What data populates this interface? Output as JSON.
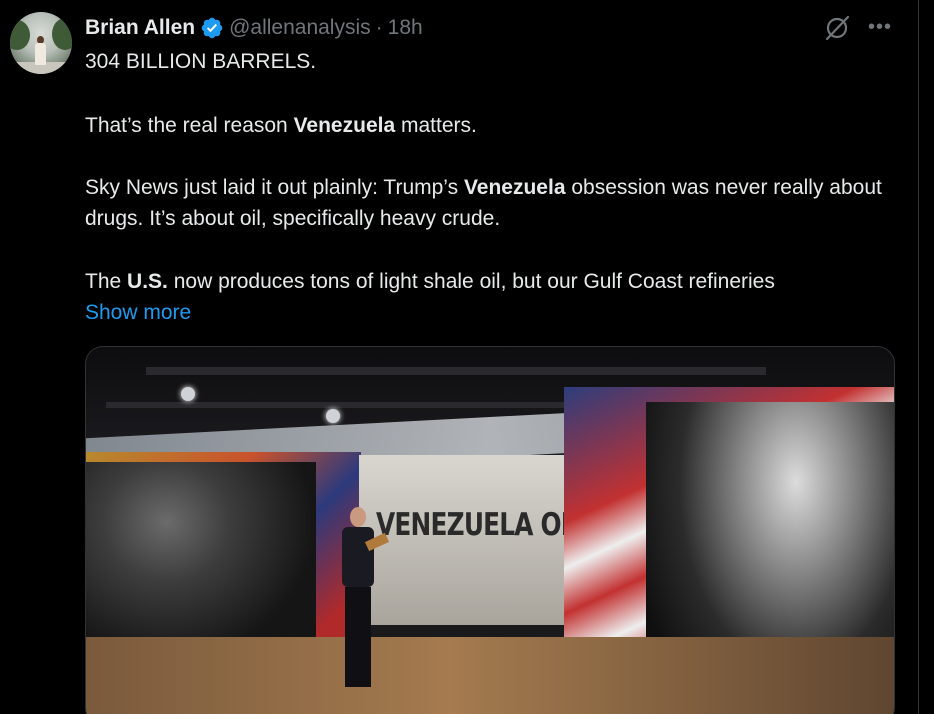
{
  "post": {
    "author_name": "Brian Allen",
    "handle": "@allenanalysis",
    "separator": "·",
    "time": "18h",
    "paragraphs": {
      "p1": "304 BILLION BARRELS.",
      "p2_a": "That’s the real reason ",
      "p2_b": "Venezuela",
      "p2_c": " matters.",
      "p3_a": "Sky News just laid it out plainly: Trump’s ",
      "p3_b": "Venezuela",
      "p3_c": " obsession was never really about drugs. It’s about oil, specifically heavy crude.",
      "p4_a": "The ",
      "p4_b": "U.S.",
      "p4_c": " now produces tons of light shale oil, but our Gulf Coast refineries"
    },
    "show_more": "Show more"
  },
  "media": {
    "title_card": "VENEZUELA OIL"
  },
  "icons": {
    "verified": "verified-badge-icon",
    "grok": "grok-icon",
    "more": "more-icon"
  },
  "colors": {
    "background": "#000000",
    "text": "#e7e9ea",
    "muted": "#71767b",
    "link": "#1d9bf0"
  }
}
